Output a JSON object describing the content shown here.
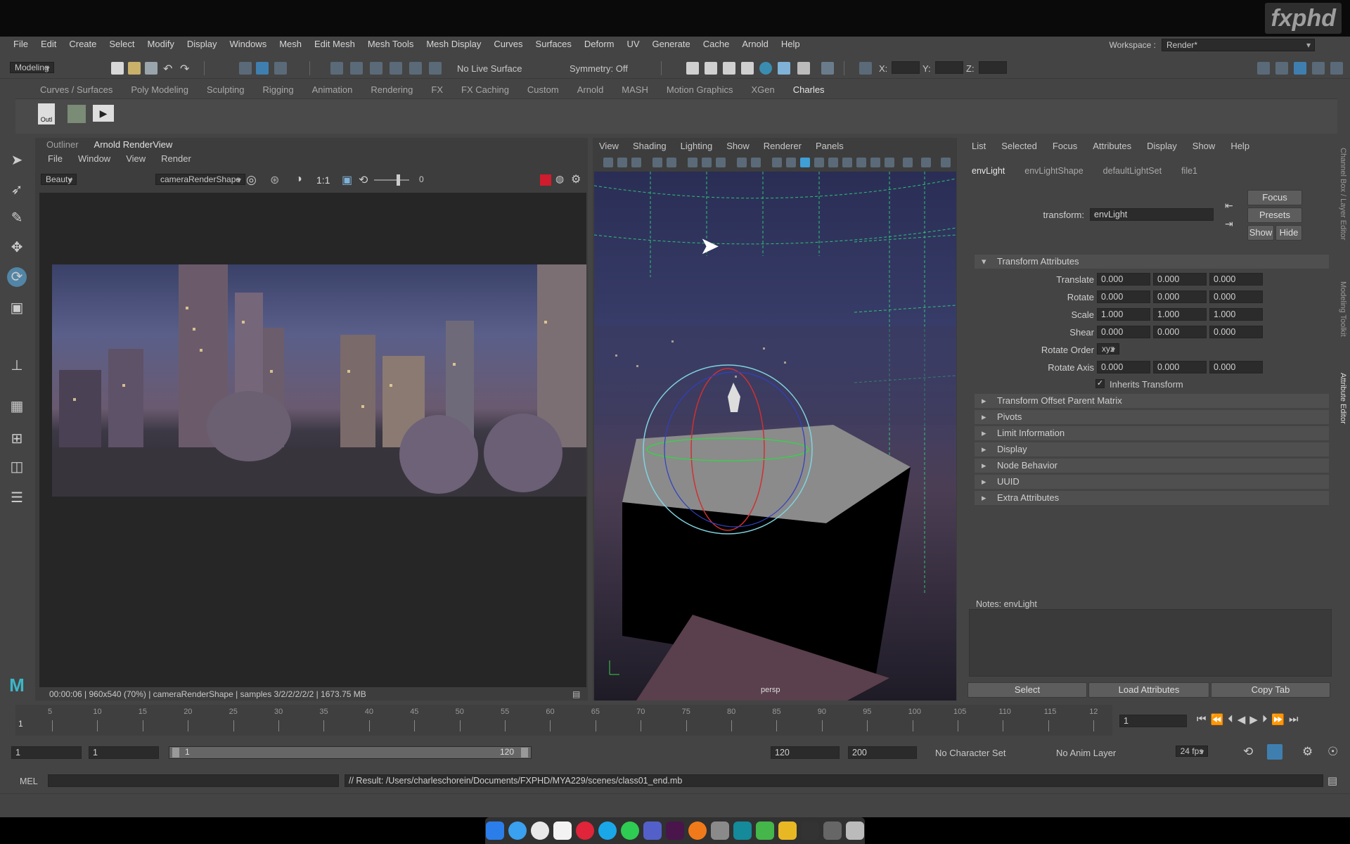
{
  "watermark": "fxphd",
  "menubar": [
    "File",
    "Edit",
    "Create",
    "Select",
    "Modify",
    "Display",
    "Windows",
    "Mesh",
    "Edit Mesh",
    "Mesh Tools",
    "Mesh Display",
    "Curves",
    "Surfaces",
    "Deform",
    "UV",
    "Generate",
    "Cache",
    "Arnold",
    "Help"
  ],
  "workspace": {
    "label": "Workspace :",
    "value": "Render*"
  },
  "toolbar": {
    "mode": "Modeling",
    "live_surface": "No Live Surface",
    "symmetry": "Symmetry: Off",
    "x_label": "X:",
    "y_label": "Y:",
    "z_label": "Z:"
  },
  "shelf_tabs": [
    "Curves / Surfaces",
    "Poly Modeling",
    "Sculpting",
    "Rigging",
    "Animation",
    "Rendering",
    "FX",
    "FX Caching",
    "Custom",
    "Arnold",
    "MASH",
    "Motion Graphics",
    "XGen",
    "Charles"
  ],
  "shelf_active": "Charles",
  "shelf_icon_label": "Outl",
  "renderview": {
    "tabs": [
      "Outliner",
      "Arnold RenderView"
    ],
    "menu": [
      "File",
      "Window",
      "View",
      "Render"
    ],
    "aov": "Beauty",
    "camera": "cameraRenderShape",
    "ratio": "1:1",
    "exposure": "0",
    "status": "00:00:06 | 960x540 (70%) | cameraRenderShape  | samples 3/2/2/2/2/2 | 1673.75 MB"
  },
  "viewport": {
    "menu": [
      "View",
      "Shading",
      "Lighting",
      "Show",
      "Renderer",
      "Panels"
    ],
    "camera_label": "persp"
  },
  "attribute_editor": {
    "menu": [
      "List",
      "Selected",
      "Focus",
      "Attributes",
      "Display",
      "Show",
      "Help"
    ],
    "tabs": [
      "envLight",
      "envLightShape",
      "defaultLightSet",
      "file1"
    ],
    "active_tab": "envLight",
    "transform_label": "transform:",
    "transform_value": "envLight",
    "buttons": {
      "focus": "Focus",
      "presets": "Presets",
      "show": "Show",
      "hide": "Hide"
    },
    "section_open": "Transform Attributes",
    "translate": {
      "label": "Translate",
      "x": "0.000",
      "y": "0.000",
      "z": "0.000"
    },
    "rotate": {
      "label": "Rotate",
      "x": "0.000",
      "y": "0.000",
      "z": "0.000"
    },
    "scale": {
      "label": "Scale",
      "x": "1.000",
      "y": "1.000",
      "z": "1.000"
    },
    "shear": {
      "label": "Shear",
      "x": "0.000",
      "y": "0.000",
      "z": "0.000"
    },
    "rotate_order": {
      "label": "Rotate Order",
      "value": "xyz"
    },
    "rotate_axis": {
      "label": "Rotate Axis",
      "x": "0.000",
      "y": "0.000",
      "z": "0.000"
    },
    "inherits": "Inherits Transform",
    "sections": [
      "Transform Offset Parent Matrix",
      "Pivots",
      "Limit Information",
      "Display",
      "Node Behavior",
      "UUID",
      "Extra Attributes"
    ],
    "notes_label": "Notes:  envLight",
    "bottom_buttons": [
      "Select",
      "Load Attributes",
      "Copy Tab"
    ],
    "side_tabs": [
      "Channel Box / Layer Editor",
      "Modeling Toolkit",
      "Attribute Editor"
    ]
  },
  "timeline": {
    "ticks": [
      "5",
      "10",
      "15",
      "20",
      "25",
      "30",
      "35",
      "40",
      "45",
      "50",
      "55",
      "60",
      "65",
      "70",
      "75",
      "80",
      "85",
      "90",
      "95",
      "100",
      "105",
      "110",
      "115",
      "12"
    ],
    "start_label": "1",
    "current_frame": "1"
  },
  "range": {
    "start": "1",
    "playback_start": "1",
    "slider_start": "1",
    "slider_end": "120",
    "end": "120",
    "anim_end": "200",
    "character_set": "No Character Set",
    "anim_layer": "No Anim Layer",
    "fps": "24 fps"
  },
  "command": {
    "lang": "MEL",
    "result": "// Result: /Users/charleschorein/Documents/FXPHD/MYA229/scenes/class01_end.mb"
  },
  "colors": {
    "ui_bg": "#444444",
    "field_bg": "#2b2b2b",
    "accent": "#5285a6",
    "active_icon": "#3f7fb0"
  }
}
